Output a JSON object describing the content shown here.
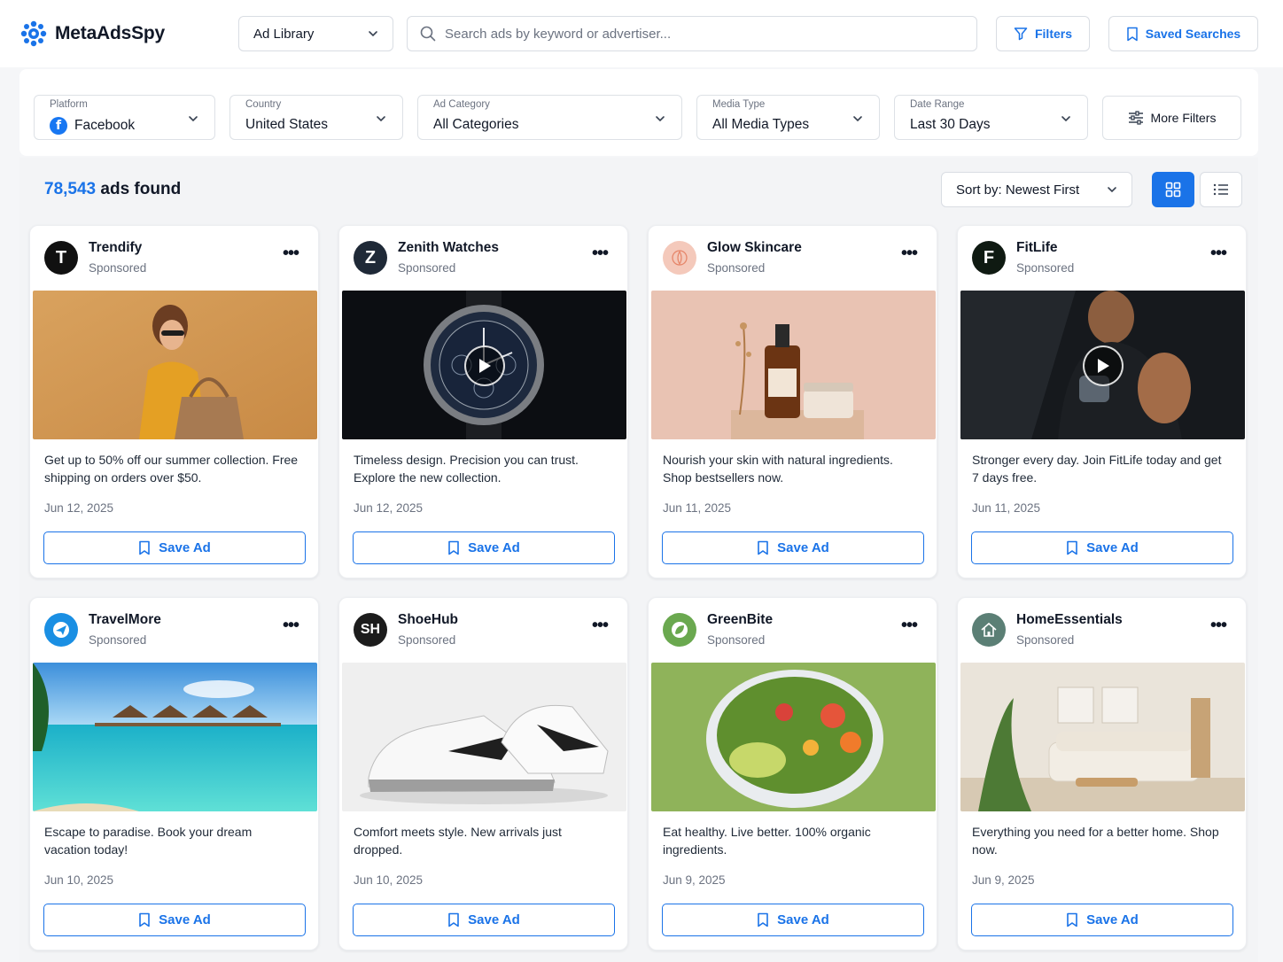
{
  "app": {
    "name": "MetaAdsSpy"
  },
  "header": {
    "library_select": "Ad Library",
    "search_placeholder": "Search ads by keyword or advertiser...",
    "filters_label": "Filters",
    "saved_searches_label": "Saved Searches"
  },
  "filters": {
    "platform": {
      "label": "Platform",
      "value": "Facebook"
    },
    "country": {
      "label": "Country",
      "value": "United States"
    },
    "category": {
      "label": "Ad Category",
      "value": "All Categories"
    },
    "media": {
      "label": "Media Type",
      "value": "All Media Types"
    },
    "date": {
      "label": "Date Range",
      "value": "Last 30 Days"
    },
    "more": "More Filters"
  },
  "results": {
    "count": "78,543",
    "count_suffix": " ads found",
    "sort": "Sort by: Newest First"
  },
  "cards": [
    {
      "advertiser": "Trendify",
      "sponsored": "Sponsored",
      "avatar": "T",
      "avatar_color": "#111111",
      "text": "Get up to 50% off our summer collection. Free shipping on orders over $50.",
      "date": "Jun 12, 2025",
      "save": "Save Ad",
      "video": false
    },
    {
      "advertiser": "Zenith Watches",
      "sponsored": "Sponsored",
      "avatar": "Z",
      "avatar_color": "#1f2937",
      "text": "Timeless design. Precision you can trust. Explore the new collection.",
      "date": "Jun 12, 2025",
      "save": "Save Ad",
      "video": true
    },
    {
      "advertiser": "Glow Skincare",
      "sponsored": "Sponsored",
      "avatar": "",
      "avatar_color": "#f4c9bb",
      "text": "Nourish your skin with natural ingredients. Shop bestsellers now.",
      "date": "Jun 11, 2025",
      "save": "Save Ad",
      "video": false
    },
    {
      "advertiser": "FitLife",
      "sponsored": "Sponsored",
      "avatar": "F",
      "avatar_color": "#0f1a12",
      "text": "Stronger every day. Join FitLife today and get 7 days free.",
      "date": "Jun 11, 2025",
      "save": "Save Ad",
      "video": true
    },
    {
      "advertiser": "TravelMore",
      "sponsored": "Sponsored",
      "avatar": "",
      "avatar_color": "#1a8fe3",
      "text": "Escape to paradise. Book your dream vacation today!",
      "date": "Jun 10, 2025",
      "save": "Save Ad",
      "video": false
    },
    {
      "advertiser": "ShoeHub",
      "sponsored": "Sponsored",
      "avatar": "SH",
      "avatar_color": "#1c1c1c",
      "text": "Comfort meets style. New arrivals just dropped.",
      "date": "Jun 10, 2025",
      "save": "Save Ad",
      "video": false
    },
    {
      "advertiser": "GreenBite",
      "sponsored": "Sponsored",
      "avatar": "",
      "avatar_color": "#6aa84f",
      "text": "Eat healthy. Live better. 100% organic ingredients.",
      "date": "Jun 9, 2025",
      "save": "Save Ad",
      "video": false
    },
    {
      "advertiser": "HomeEssentials",
      "sponsored": "Sponsored",
      "avatar": "",
      "avatar_color": "#5b7f75",
      "text": "Everything you need for a better home. Shop now.",
      "date": "Jun 9, 2025",
      "save": "Save Ad",
      "video": false
    }
  ],
  "colors": {
    "accent": "#1a73e8",
    "text": "#111827",
    "muted": "#6b7280"
  }
}
